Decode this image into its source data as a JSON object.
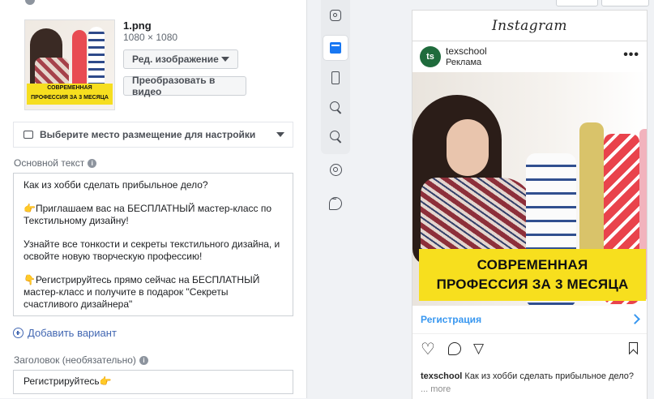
{
  "ad_editor": {
    "media": {
      "file_name": "1.png",
      "dimensions": "1080 × 1080",
      "thumbnail_banner": [
        "СОВРЕМЕННАЯ",
        "ПРОФЕССИЯ ЗА 3 МЕСЯЦА"
      ],
      "edit_image_label": "Ред. изображение",
      "convert_to_video_label": "Преобразовать в видео"
    },
    "placement_select": {
      "label": "Выберите место размещение для настройки"
    },
    "primary_text": {
      "label": "Основной текст",
      "lines": [
        "Как из хобби сделать прибыльное дело?",
        "",
        "👉Приглашаем вас на БЕСПЛАТНЫЙ мастер-класс по",
        "Текстильному дизайну!",
        "",
        "Узнайте все тонкости и секреты текстильного дизайна, и",
        "освойте новую творческую профессию!",
        "",
        "👇Регистрируйтесь прямо сейчас на БЕСПЛАТНЫЙ",
        "мастер-класс и получите в подарок \"Секреты",
        "счастливого дизайнера\""
      ]
    },
    "add_variant_label": "Добавить вариант",
    "headline": {
      "label": "Заголовок (необязательно)",
      "value": "Регистрируйтесь👉"
    }
  },
  "placement_toolbar": {
    "icons": [
      "instagram-icon",
      "feed-icon",
      "stories-icon",
      "search-icon",
      "search-results-icon",
      "marketplace-icon",
      "messenger-icon"
    ],
    "active": "feed-icon"
  },
  "preview": {
    "app_logo": "Instagram",
    "account": "texschool",
    "avatar_text": "ts",
    "sponsored": "Реклама",
    "image_banner": [
      "СОВРЕМЕННАЯ",
      "ПРОФЕССИЯ ЗА 3 МЕСЯЦА"
    ],
    "cta_label": "Регистрация",
    "caption_account": "texschool",
    "caption_text": "Как из хобби сделать прибыльное дело?",
    "more_label": "... more"
  },
  "colors": {
    "accent_blue": "#4267b2",
    "instagram_cta": "#3897f0",
    "banner_yellow": "#f7df1e"
  }
}
